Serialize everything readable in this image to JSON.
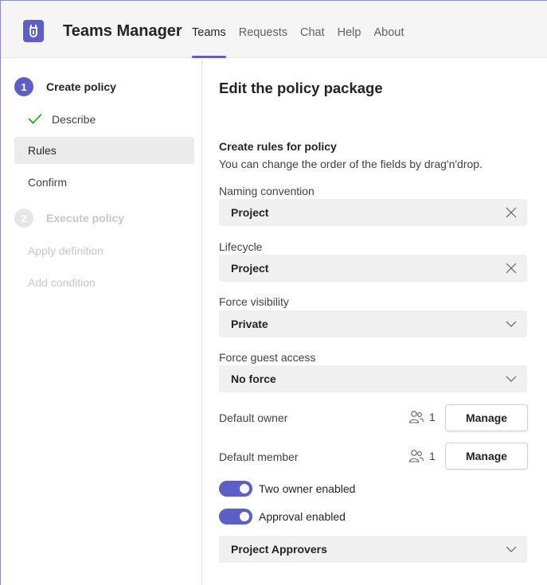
{
  "header": {
    "app_name": "Teams Manager",
    "tabs": [
      {
        "label": "Teams",
        "active": true
      },
      {
        "label": "Requests"
      },
      {
        "label": "Chat"
      },
      {
        "label": "Help"
      },
      {
        "label": "About"
      }
    ],
    "accent_color": "#5b5fc7"
  },
  "sidebar": {
    "step1": {
      "number": "1",
      "label": "Create policy"
    },
    "items1": [
      {
        "label": "Describe",
        "state": "completed"
      },
      {
        "label": "Rules",
        "state": "selected"
      },
      {
        "label": "Confirm"
      }
    ],
    "step2": {
      "number": "2",
      "label": "Execute policy"
    },
    "items2": [
      {
        "label": "Apply definition",
        "state": "disabled"
      },
      {
        "label": "Add condition",
        "state": "disabled"
      }
    ]
  },
  "main": {
    "title": "Edit the policy package",
    "section_title": "Create rules for policy",
    "section_subtitle": "You can change the order of the fields by drag'n'drop.",
    "naming": {
      "label": "Naming convention",
      "value": "Project",
      "icon": "close-icon"
    },
    "lifecycle": {
      "label": "Lifecycle",
      "value": "Project",
      "icon": "close-icon"
    },
    "visibility": {
      "label": "Force visibility",
      "value": "Private",
      "icon": "chevron-down-icon"
    },
    "guest": {
      "label": "Force guest access",
      "value": "No force",
      "icon": "chevron-down-icon"
    },
    "owner": {
      "label": "Default owner",
      "count": "1",
      "button": "Manage"
    },
    "member": {
      "label": "Default member",
      "count": "1",
      "button": "Manage"
    },
    "two_owner": {
      "label": "Two owner enabled",
      "on": true
    },
    "approval": {
      "label": "Approval enabled",
      "on": true
    },
    "approvers": {
      "value": "Project Approvers",
      "icon": "chevron-down-icon"
    }
  }
}
